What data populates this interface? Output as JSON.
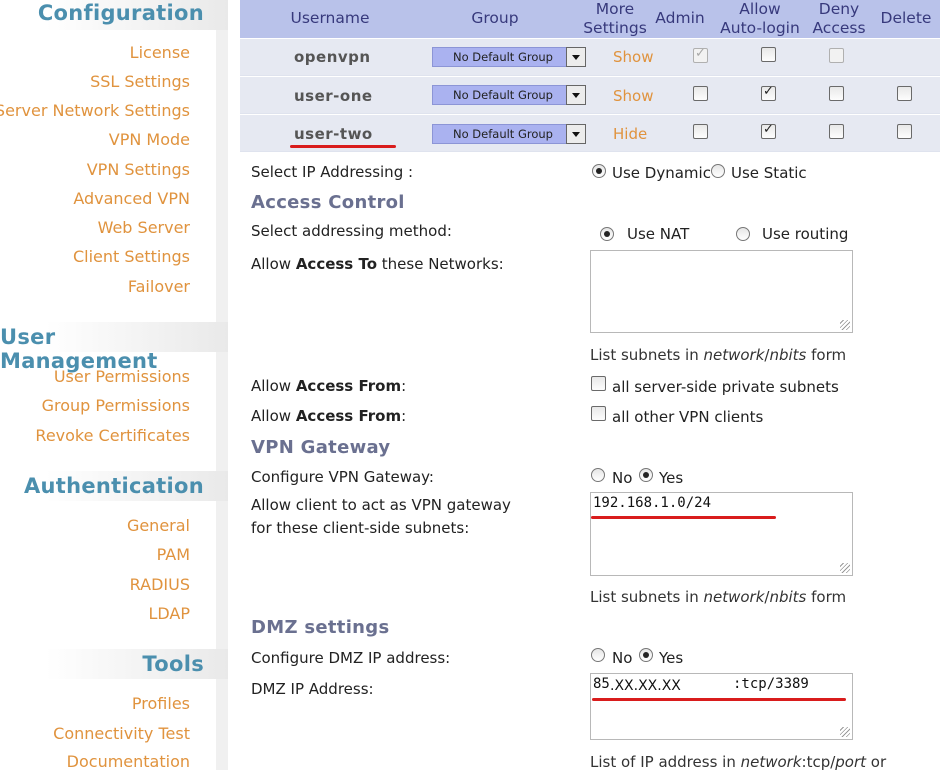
{
  "sidebar": {
    "configuration": {
      "title": "Configuration",
      "items": [
        "License",
        "SSL Settings",
        "Server Network Settings",
        "VPN Mode",
        "VPN Settings",
        "Advanced VPN",
        "Web Server",
        "Client Settings",
        "Failover"
      ]
    },
    "user_management": {
      "title": "User Management",
      "items": [
        "User Permissions",
        "Group Permissions",
        "Revoke Certificates"
      ]
    },
    "authentication": {
      "title": "Authentication",
      "items": [
        "General",
        "PAM",
        "RADIUS",
        "LDAP"
      ]
    },
    "tools": {
      "title": "Tools",
      "items": [
        "Profiles",
        "Connectivity Test",
        "Documentation"
      ]
    }
  },
  "table": {
    "headers": {
      "username": "Username",
      "group": "Group",
      "more_settings_1": "More",
      "more_settings_2": "Settings",
      "admin": "Admin",
      "auto_login_1": "Allow",
      "auto_login_2": "Auto-login",
      "deny_1": "Deny",
      "deny_2": "Access",
      "delete": "Delete"
    },
    "rows": [
      {
        "username": "openvpn",
        "group": "No Default Group",
        "settings_link": "Show",
        "admin": true,
        "auto_login": false,
        "deny": false,
        "delete": null
      },
      {
        "username": "user-one",
        "group": "No Default Group",
        "settings_link": "Show",
        "admin": false,
        "auto_login": true,
        "deny": false,
        "delete": false
      },
      {
        "username": "user-two",
        "group": "No Default Group",
        "settings_link": "Hide",
        "admin": false,
        "auto_login": true,
        "deny": false,
        "delete": false
      }
    ]
  },
  "details": {
    "ip_addressing": {
      "label": "Select IP Addressing :",
      "dynamic": "Use Dynamic",
      "static": "Use Static",
      "selected": "dynamic"
    },
    "access_control": {
      "heading": "Access Control",
      "method_label": "Select addressing method:",
      "nat": "Use NAT",
      "routing": "Use routing",
      "selected": "nat",
      "networks_label_1": "Allow ",
      "networks_label_bold": "Access To",
      "networks_label_2": " these Networks:",
      "networks_value": "",
      "hint_1": "List subnets in ",
      "hint_italic": "network",
      "hint_2": "/",
      "hint_italic2": "nbits",
      "hint_3": " form",
      "from_label_1": "Allow ",
      "from_label_bold": "Access From",
      "from_label_2": ":",
      "from_server": "all server-side private subnets",
      "from_clients": "all other VPN clients"
    },
    "vpn_gateway": {
      "heading": "VPN Gateway",
      "configure_label": "Configure VPN Gateway:",
      "no": "No",
      "yes": "Yes",
      "selected": "yes",
      "subnets_label_1": "Allow client to act as VPN gateway",
      "subnets_label_2": "for these client-side subnets:",
      "subnets_value": "192.168.1.0/24",
      "hint_1": "List subnets in ",
      "hint_italic": "network",
      "hint_2": "/",
      "hint_italic2": "nbits",
      "hint_3": " form"
    },
    "dmz": {
      "heading": "DMZ settings",
      "configure_label": "Configure DMZ IP address:",
      "no": "No",
      "yes": "Yes",
      "selected": "yes",
      "address_label": "DMZ IP Address:",
      "address_prefix": "85",
      "address_masked": ".XX.XX.XX",
      "address_suffix": ":tcp/3389",
      "hint_1": "List of IP address in ",
      "hint_italic": "network",
      "hint_2": ":tcp/",
      "hint_italic2": "port",
      "hint_3": " or"
    }
  },
  "colors": {
    "accent_title": "#4b8fae",
    "link_orange": "#e0933e",
    "header_bg": "#b9c2ea",
    "annotation_red": "#d91c1c"
  }
}
